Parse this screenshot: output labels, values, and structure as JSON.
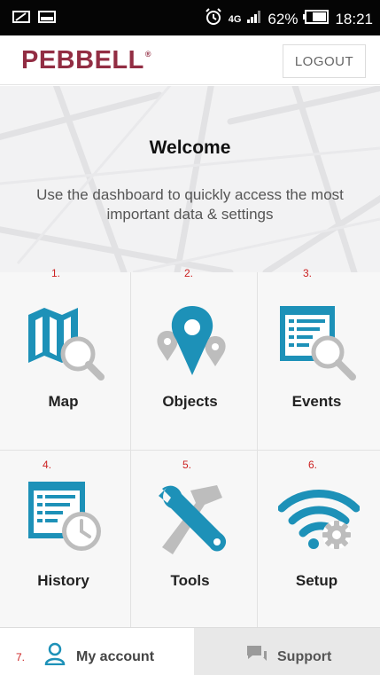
{
  "status_bar": {
    "battery_percent": "62%",
    "network": "4G",
    "time": "18:21"
  },
  "header": {
    "logo": "PEBBELL",
    "logo_mark": "®",
    "logout_label": "LOGOUT"
  },
  "hero": {
    "title": "Welcome",
    "subtitle": "Use the dashboard to quickly access the most important data & settings"
  },
  "tiles": [
    {
      "number": "1.",
      "label": "Map",
      "icon": "map-search-icon"
    },
    {
      "number": "2.",
      "label": "Objects",
      "icon": "location-pins-icon"
    },
    {
      "number": "3.",
      "label": "Events",
      "icon": "list-search-icon"
    },
    {
      "number": "4.",
      "label": "History",
      "icon": "list-clock-icon"
    },
    {
      "number": "5.",
      "label": "Tools",
      "icon": "wrench-hammer-icon"
    },
    {
      "number": "6.",
      "label": "Setup",
      "icon": "wifi-gear-icon"
    }
  ],
  "bottom_tabs": {
    "account_number": "7.",
    "account_label": "My account",
    "support_label": "Support"
  },
  "colors": {
    "brand": "#922d43",
    "icon_blue": "#1d91b8",
    "icon_gray": "#bdbdbd",
    "number_red": "#cc2222"
  }
}
